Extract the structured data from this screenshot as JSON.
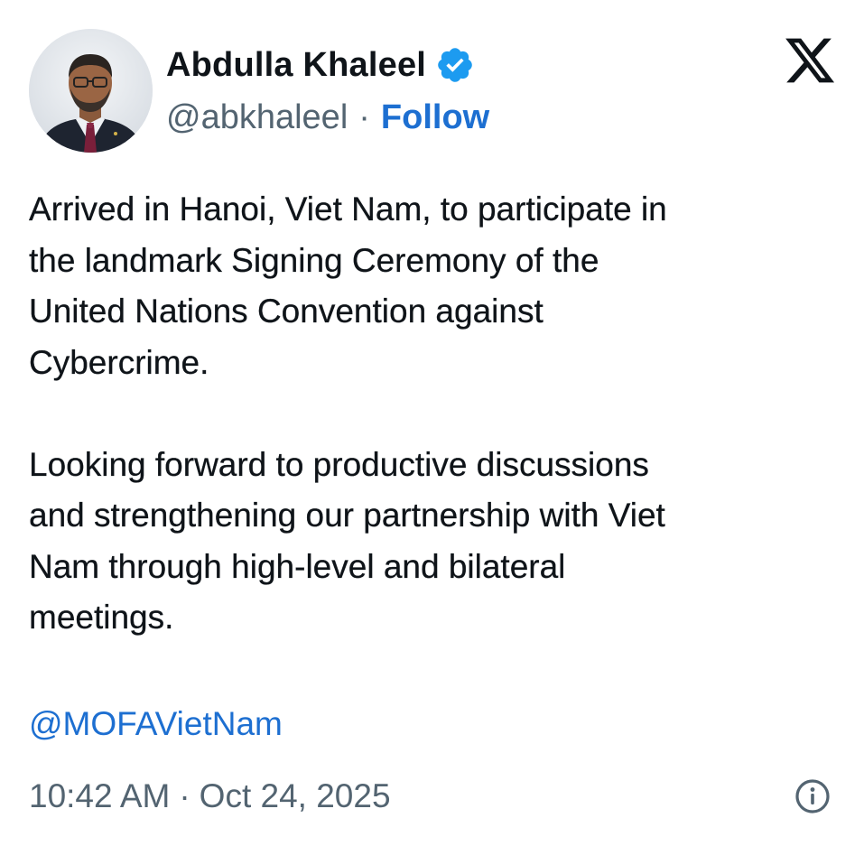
{
  "author": {
    "display_name": "Abdulla Khaleel",
    "handle": "@abkhaleel",
    "separator": "·",
    "follow_label": "Follow",
    "verified_icon": "verified-badge-icon",
    "avatar": "profile-photo"
  },
  "brand": {
    "logo_icon": "x-logo-icon"
  },
  "tweet": {
    "paragraphs": [
      "Arrived in Hanoi, Viet Nam, to participate in\nthe landmark Signing Ceremony of the\nUnited Nations Convention against\nCybercrime.",
      "Looking forward to productive discussions\nand strengthening our partnership with Viet\nNam through high-level and bilateral\nmeetings."
    ],
    "mention": "@MOFAVietNam"
  },
  "meta": {
    "time": "10:42 AM",
    "separator": "·",
    "date": "Oct 24, 2025",
    "info_icon": "info-icon"
  },
  "colors": {
    "text": "#0f1419",
    "secondary": "#536471",
    "link": "#1d6fd1",
    "verified": "#1d9bf0",
    "background": "#ffffff"
  }
}
